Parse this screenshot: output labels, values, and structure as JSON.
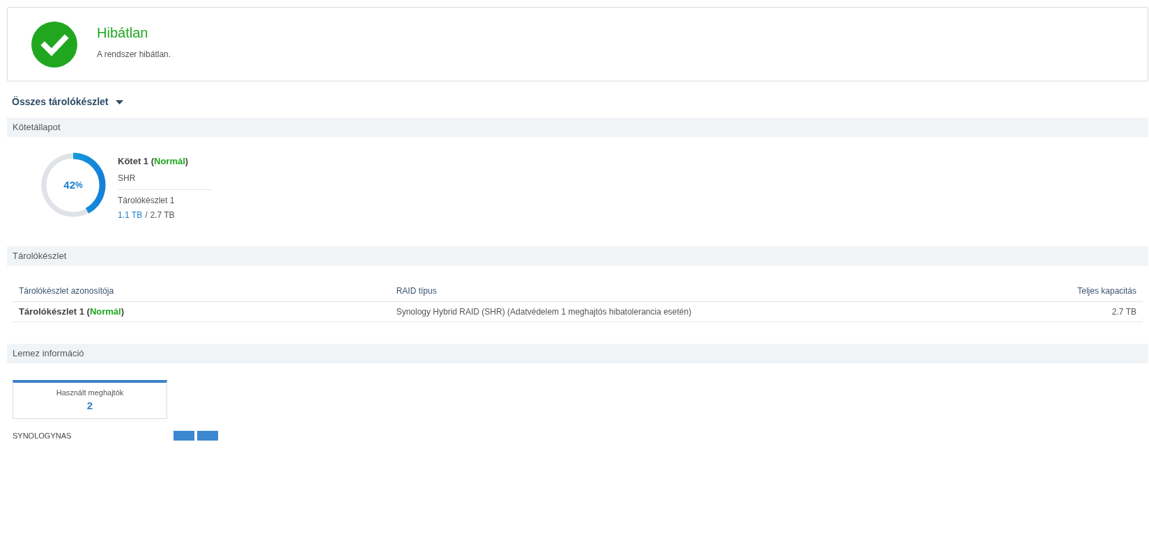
{
  "status": {
    "kind": "healthy",
    "title": "Hibátlan",
    "message": "A rendszer hibátlan."
  },
  "pool_selector": {
    "label": "Összes tárolókészlet"
  },
  "volume_section": {
    "title": "Kötetállapot",
    "volume": {
      "level": 0.42,
      "percent": "42",
      "unit": "%",
      "title": "Kötet 1 (**Normál**)",
      "type": "SHR",
      "pool": "Tárolókészlet 1",
      "used": "1.1 TB",
      "separator": "/",
      "total": "2.7 TB"
    }
  },
  "pool_section": {
    "title": "Tárolókészlet",
    "columns": [
      "Tárolókészlet azonosítója",
      "RAID típus",
      "Teljes kapacitás"
    ],
    "rows": [
      {
        "id": "Tárolókészlet 1 (**Normál**)",
        "raid": "Synology Hybrid RAID (SHR) (Adatvédelem 1 meghajtós hibatolerancia esetén)",
        "capacity": "2.7 TB"
      }
    ]
  },
  "disk_section": {
    "title": "Lemez információ",
    "summary": {
      "label": "Használt meghajtók",
      "value": "2"
    },
    "host": "SYNOLOGYNAS",
    "drives": [
      {
        "kind": "used"
      },
      {
        "kind": "used"
      }
    ]
  }
}
